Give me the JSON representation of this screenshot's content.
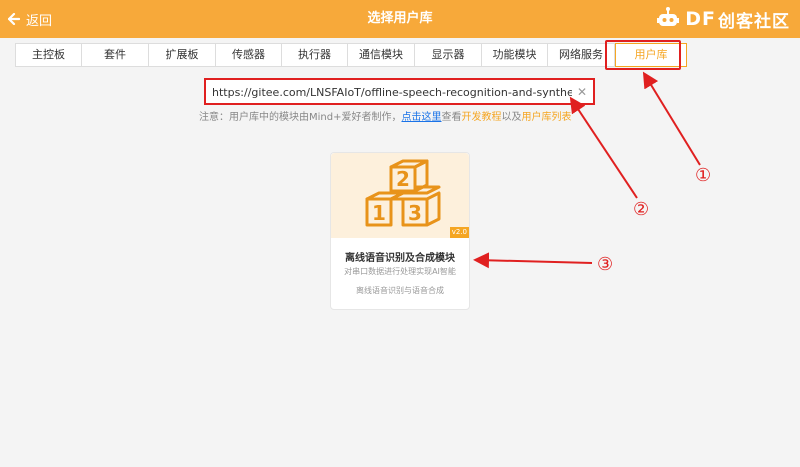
{
  "header": {
    "back_label": "返回",
    "title": "选择用户库",
    "brand_prefix": "DF",
    "brand_name": "创客社区",
    "color": "#f7a93a"
  },
  "tabs": [
    {
      "label": "主控板",
      "active": false
    },
    {
      "label": "套件",
      "active": false
    },
    {
      "label": "扩展板",
      "active": false
    },
    {
      "label": "传感器",
      "active": false
    },
    {
      "label": "执行器",
      "active": false
    },
    {
      "label": "通信模块",
      "active": false
    },
    {
      "label": "显示器",
      "active": false
    },
    {
      "label": "功能模块",
      "active": false
    },
    {
      "label": "网络服务",
      "active": false
    },
    {
      "label": "用户库",
      "active": true
    }
  ],
  "search": {
    "value": "https://gitee.com/LNSFAIoT/offline-speech-recognition-and-synthesis-modules",
    "clear_icon": "close-icon"
  },
  "notice": {
    "prefix": "注意：用户库中的模块由Mind+爱好者制作，",
    "link": "点击这里",
    "mid1": "查看",
    "tutorial": "开发教程",
    "mid2": "以及",
    "list": "用户库列表"
  },
  "card": {
    "icon": "blocks-123-icon",
    "blocks": [
      "1",
      "2",
      "3"
    ],
    "version": "v2.0",
    "title": "离线语音识别及合成模块",
    "desc": "对串口数据进行处理实现AI智能",
    "sub": "离线语音识别与语音合成"
  },
  "annotations": {
    "marker1": "①",
    "marker2": "②",
    "marker3": "③",
    "color": "#e02020"
  }
}
